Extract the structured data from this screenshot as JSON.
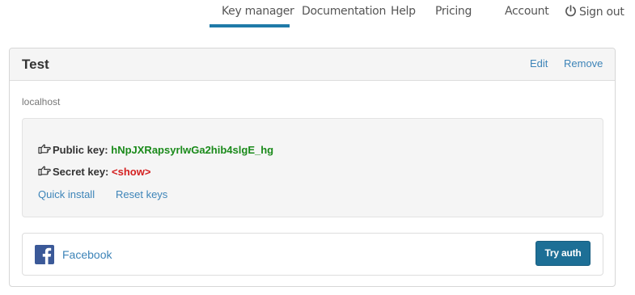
{
  "nav": {
    "items": [
      {
        "label": "Key manager",
        "active": true
      },
      {
        "label": "Documentation",
        "active": false
      },
      {
        "label": "Help",
        "active": false
      },
      {
        "label": "Pricing",
        "active": false
      },
      {
        "label": "Account",
        "active": false
      }
    ],
    "signout_label": "Sign out",
    "signout_icon": "power-icon"
  },
  "app": {
    "title": "Test",
    "edit_label": "Edit",
    "remove_label": "Remove",
    "domain": "localhost",
    "keys": {
      "public_label": "Public key:",
      "public_value": "hNpJXRapsyrlwGa2hib4slgE_hg",
      "secret_label": "Secret key:",
      "secret_value": "<show>",
      "icon": "hand-point-right-icon"
    },
    "quick_install_label": "Quick install",
    "reset_keys_label": "Reset keys"
  },
  "provider": {
    "name": "Facebook",
    "icon": "facebook-icon",
    "button_label": "Try auth"
  },
  "colors": {
    "accent": "#1f7aa8",
    "link": "#3d84b8",
    "public_key": "#1a8a1a",
    "secret_key": "#d42020",
    "facebook": "#3b5998",
    "button": "#1d6f96"
  }
}
